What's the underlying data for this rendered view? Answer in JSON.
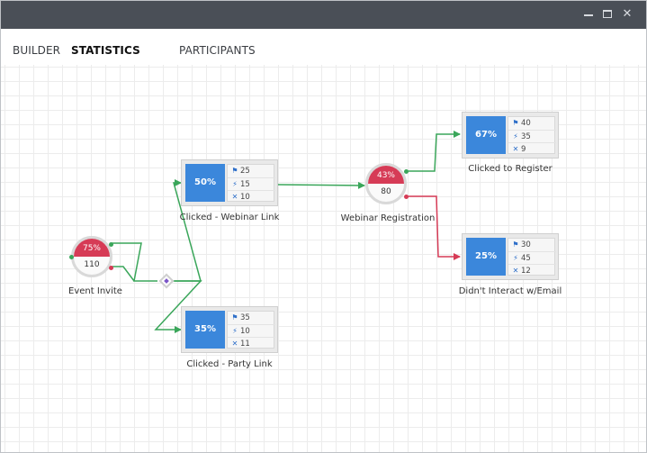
{
  "window": {
    "controls": {
      "minimize": "minimize",
      "maximize": "maximize",
      "close": "✕"
    }
  },
  "tabs": [
    {
      "label": "BUILDER",
      "active": false
    },
    {
      "label": "STATISTICS",
      "active": true
    },
    {
      "label": "PARTICIPANTS",
      "active": false
    }
  ],
  "colors": {
    "titlebar": "#4a4f57",
    "accent_blue": "#3b87db",
    "link_green": "#3aa65a",
    "link_red": "#d63b56",
    "split_purple": "#7b56c8"
  },
  "icons": {
    "stat_row_1": "flag-icon",
    "stat_row_2": "runner-icon",
    "stat_row_3": "x-icon"
  },
  "flow": {
    "event_invite": {
      "label": "Event Invite",
      "percent": "75%",
      "count": "110"
    },
    "webinar_registration": {
      "label": "Webinar Registration",
      "percent": "43%",
      "count": "80"
    },
    "clicked_webinar_link": {
      "label": "Clicked - Webinar Link",
      "percent": "50%",
      "stats": [
        "25",
        "15",
        "10"
      ]
    },
    "clicked_party_link": {
      "label": "Clicked - Party Link",
      "percent": "35%",
      "stats": [
        "35",
        "10",
        "11"
      ]
    },
    "clicked_to_register": {
      "label": "Clicked to Register",
      "percent": "67%",
      "stats": [
        "40",
        "35",
        "9"
      ]
    },
    "didnt_interact": {
      "label": "Didn't Interact w/Email",
      "percent": "25%",
      "stats": [
        "30",
        "45",
        "12"
      ]
    }
  }
}
